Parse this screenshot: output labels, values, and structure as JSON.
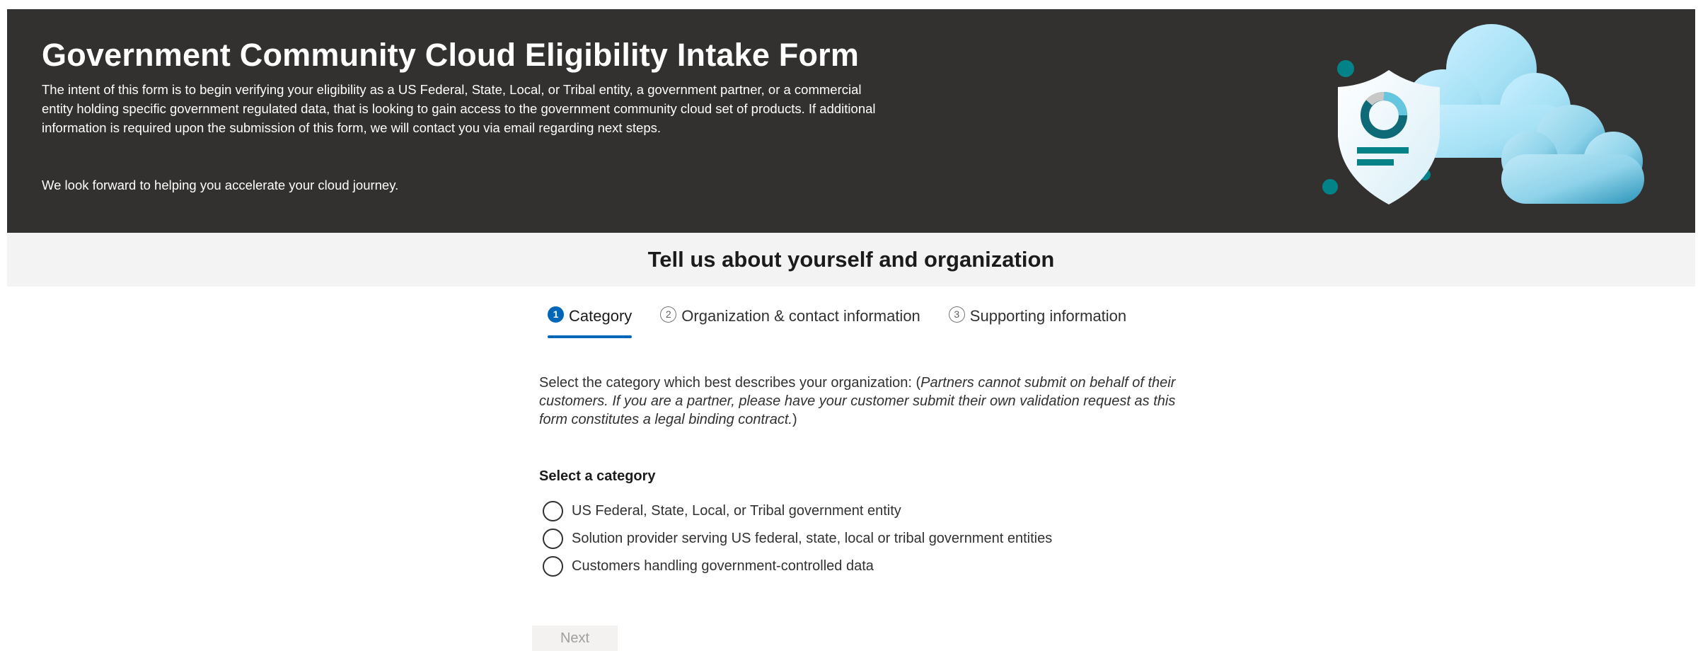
{
  "hero": {
    "title": "Government Community Cloud Eligibility Intake Form",
    "description": "The intent of this form is to begin verifying your eligibility as a US Federal, State, Local, or Tribal entity, a government partner, or a commercial entity holding specific government regulated data, that is looking to gain access to the government community cloud set of products. If additional information is required upon the submission of this form, we will contact you via email regarding next steps.",
    "closing": "We look forward to helping you accelerate your cloud journey.",
    "illustration": "shield-and-clouds-illustration"
  },
  "section": {
    "title": "Tell us about yourself and organization"
  },
  "stepper": {
    "steps": [
      {
        "number": "1",
        "label": "Category",
        "active": true
      },
      {
        "number": "2",
        "label": "Organization & contact information",
        "active": false
      },
      {
        "number": "3",
        "label": "Supporting information",
        "active": false
      }
    ]
  },
  "form": {
    "intro_prefix": "Select the category which best describes your organization: (",
    "intro_italic": "Partners cannot submit on behalf of their customers. If you are a partner, please have your customer submit their own validation request as this form constitutes a legal binding contract.",
    "intro_suffix": ")",
    "category_label": "Select a category",
    "options": [
      "US Federal, State, Local, or Tribal government entity",
      "Solution provider serving US federal, state, local or tribal government entities",
      "Customers handling government-controlled data"
    ],
    "next_label": "Next"
  },
  "colors": {
    "hero_background": "#323130",
    "accent": "#0067b8",
    "section_band": "#f3f3f3",
    "teal": "#038387",
    "cloud": "#9fdcf2"
  }
}
